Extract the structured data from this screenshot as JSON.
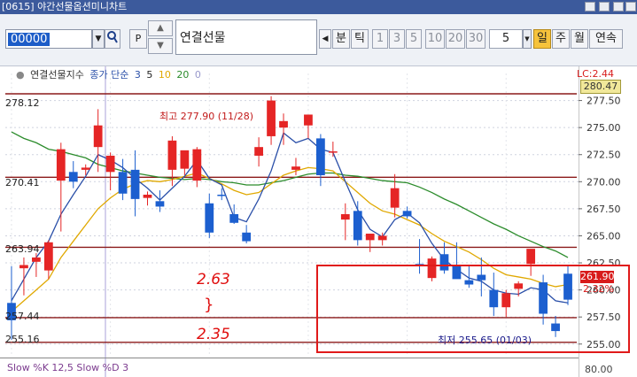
{
  "window": {
    "title": "[0615] 야간선물옵션미니차트"
  },
  "toolbar": {
    "code": "00000",
    "p_label": "P",
    "product_name": "연결선물",
    "bun_label": "분",
    "tick_label": "틱",
    "intervals": [
      "1",
      "3",
      "5",
      "10",
      "20",
      "30"
    ],
    "count_value": "5",
    "period_buttons": [
      "일",
      "주",
      "월",
      "연속"
    ],
    "active_period": "일"
  },
  "legend": {
    "title": "연결선물지수",
    "ma_label": "종가 단순",
    "ma_periods": [
      "3",
      "5",
      "10",
      "20",
      "0"
    ],
    "ma_colors": [
      "#2a4fa8",
      "#222222",
      "#e0a800",
      "#2c8c2c",
      "#9999cc"
    ]
  },
  "price_info": {
    "lc_label": "LC:2.44",
    "top_box_value": "280.47",
    "current_value": "261.90",
    "change_pct": "2.32%"
  },
  "levels": [
    {
      "label": "278.12",
      "value": 278.12
    },
    {
      "label": "270.41",
      "value": 270.41
    },
    {
      "label": "263.94",
      "value": 263.94
    },
    {
      "label": "257.44",
      "value": 257.44
    },
    {
      "label": "255.16",
      "value": 255.16
    }
  ],
  "annotations": {
    "high_label": "최고 277.90 (11/28)",
    "low_label": "최저 255.65 (01/03)",
    "handwritten_top": "2.63",
    "handwritten_mid": "}",
    "handwritten_bottom": "2.35"
  },
  "stoch_panel": {
    "label": "Slow %K 12,5   Slow %D 3",
    "scale_top": "80.00"
  },
  "chart_data": {
    "type": "candlestick",
    "y_axis_ticks": [
      "277.50",
      "275.00",
      "272.50",
      "270.00",
      "267.50",
      "265.00",
      "262.50",
      "260.00",
      "257.50",
      "255.00"
    ],
    "ylim": [
      254.0,
      280.0
    ],
    "candles": [
      {
        "o": 258.8,
        "h": 262.2,
        "l": 255.4,
        "c": 257.2
      },
      {
        "o": 262.0,
        "h": 263.0,
        "l": 259.5,
        "c": 262.3
      },
      {
        "o": 262.6,
        "h": 263.4,
        "l": 261.2,
        "c": 263.0
      },
      {
        "o": 261.8,
        "h": 264.6,
        "l": 261.0,
        "c": 264.4
      },
      {
        "o": 270.1,
        "h": 273.6,
        "l": 265.4,
        "c": 273.0
      },
      {
        "o": 270.9,
        "h": 271.9,
        "l": 269.4,
        "c": 270.0
      },
      {
        "o": 271.1,
        "h": 271.6,
        "l": 270.6,
        "c": 271.3
      },
      {
        "o": 273.2,
        "h": 276.7,
        "l": 270.9,
        "c": 275.2
      },
      {
        "o": 270.9,
        "h": 272.7,
        "l": 269.2,
        "c": 272.4
      },
      {
        "o": 270.9,
        "h": 272.1,
        "l": 268.3,
        "c": 268.9
      },
      {
        "o": 271.1,
        "h": 272.9,
        "l": 266.8,
        "c": 268.4
      },
      {
        "o": 268.5,
        "h": 269.1,
        "l": 267.8,
        "c": 268.8
      },
      {
        "o": 268.2,
        "h": 269.2,
        "l": 267.2,
        "c": 267.7
      },
      {
        "o": 271.1,
        "h": 274.2,
        "l": 269.6,
        "c": 273.8
      },
      {
        "o": 271.2,
        "h": 272.5,
        "l": 270.6,
        "c": 272.9
      },
      {
        "o": 270.1,
        "h": 273.2,
        "l": 269.5,
        "c": 273.0
      },
      {
        "o": 268.0,
        "h": 268.9,
        "l": 264.8,
        "c": 265.3
      },
      {
        "o": 268.8,
        "h": 269.4,
        "l": 268.3,
        "c": 268.7
      },
      {
        "o": 267.0,
        "h": 267.9,
        "l": 266.1,
        "c": 266.2
      },
      {
        "o": 265.3,
        "h": 266.0,
        "l": 264.3,
        "c": 264.5
      },
      {
        "o": 272.4,
        "h": 274.1,
        "l": 271.4,
        "c": 273.2
      },
      {
        "o": 274.2,
        "h": 277.9,
        "l": 273.4,
        "c": 277.5
      },
      {
        "o": 275.0,
        "h": 276.3,
        "l": 273.4,
        "c": 275.6
      },
      {
        "o": 271.1,
        "h": 272.2,
        "l": 270.6,
        "c": 271.4
      },
      {
        "o": 275.2,
        "h": 275.8,
        "l": 274.0,
        "c": 276.2
      },
      {
        "o": 274.0,
        "h": 274.4,
        "l": 269.6,
        "c": 270.6
      },
      {
        "o": 272.8,
        "h": 273.7,
        "l": 272.3,
        "c": 272.8
      },
      {
        "o": 266.5,
        "h": 268.0,
        "l": 264.6,
        "c": 267.0
      },
      {
        "o": 267.3,
        "h": 268.2,
        "l": 264.1,
        "c": 264.6
      },
      {
        "o": 264.6,
        "h": 265.2,
        "l": 263.5,
        "c": 265.2
      },
      {
        "o": 264.6,
        "h": 265.3,
        "l": 264.1,
        "c": 265.0
      },
      {
        "o": 267.6,
        "h": 270.7,
        "l": 266.7,
        "c": 269.4
      },
      {
        "o": 267.3,
        "h": 267.7,
        "l": 266.6,
        "c": 266.8
      },
      {
        "o": 262.4,
        "h": 264.7,
        "l": 261.5,
        "c": 262.2
      },
      {
        "o": 261.1,
        "h": 263.1,
        "l": 260.8,
        "c": 262.9
      },
      {
        "o": 263.3,
        "h": 264.4,
        "l": 261.5,
        "c": 261.8
      },
      {
        "o": 262.2,
        "h": 264.4,
        "l": 261.2,
        "c": 261.0
      },
      {
        "o": 260.9,
        "h": 262.3,
        "l": 260.2,
        "c": 260.5
      },
      {
        "o": 261.4,
        "h": 263.0,
        "l": 259.4,
        "c": 260.9
      },
      {
        "o": 260.0,
        "h": 261.6,
        "l": 257.6,
        "c": 258.4
      },
      {
        "o": 258.4,
        "h": 260.0,
        "l": 257.5,
        "c": 259.7
      },
      {
        "o": 260.1,
        "h": 260.8,
        "l": 259.4,
        "c": 260.6
      },
      {
        "o": 262.4,
        "h": 263.4,
        "l": 261.3,
        "c": 263.8
      },
      {
        "o": 260.7,
        "h": 261.4,
        "l": 256.8,
        "c": 257.8
      },
      {
        "o": 256.9,
        "h": 257.6,
        "l": 255.65,
        "c": 256.2
      },
      {
        "o": 261.5,
        "h": 262.3,
        "l": 258.6,
        "c": 259.1
      }
    ],
    "ma3": [
      259.0,
      261.0,
      263.0,
      264.5,
      267.0,
      268.8,
      270.5,
      272.5,
      272.0,
      271.3,
      270.3,
      269.4,
      268.3,
      269.4,
      270.5,
      272.0,
      270.3,
      269.7,
      266.7,
      266.3,
      268.4,
      271.0,
      274.5,
      273.6,
      274.0,
      273.0,
      272.7,
      270.0,
      267.4,
      265.6,
      264.9,
      266.5,
      267.1,
      266.2,
      264.3,
      262.8,
      261.9,
      261.1,
      260.8,
      260.0,
      259.7,
      259.6,
      260.2,
      260.0,
      259.0,
      258.8
    ],
    "ma10": [
      258.0,
      259.0,
      260.0,
      261.0,
      263.0,
      264.5,
      266.0,
      267.5,
      268.5,
      269.3,
      269.8,
      270.1,
      270.0,
      270.2,
      270.5,
      270.8,
      270.3,
      269.8,
      269.2,
      268.8,
      269.0,
      269.8,
      270.6,
      271.0,
      271.3,
      271.2,
      271.0,
      270.0,
      269.0,
      268.0,
      267.3,
      267.0,
      266.5,
      266.0,
      265.2,
      264.5,
      264.0,
      263.5,
      262.8,
      262.0,
      261.4,
      261.2,
      261.0,
      260.6,
      260.3,
      260.5
    ],
    "ma20": [
      274.6,
      274.0,
      273.6,
      273.0,
      272.8,
      272.5,
      272.2,
      271.6,
      271.3,
      271.0,
      270.8,
      270.6,
      270.4,
      270.3,
      270.2,
      270.3,
      270.2,
      270.0,
      269.9,
      269.7,
      269.7,
      269.9,
      270.1,
      270.4,
      270.7,
      270.8,
      270.8,
      270.6,
      270.5,
      270.3,
      270.1,
      270.0,
      269.9,
      269.5,
      269.0,
      268.4,
      267.9,
      267.3,
      266.7,
      266.1,
      265.6,
      265.0,
      264.5,
      264.0,
      263.6,
      263.0
    ]
  }
}
